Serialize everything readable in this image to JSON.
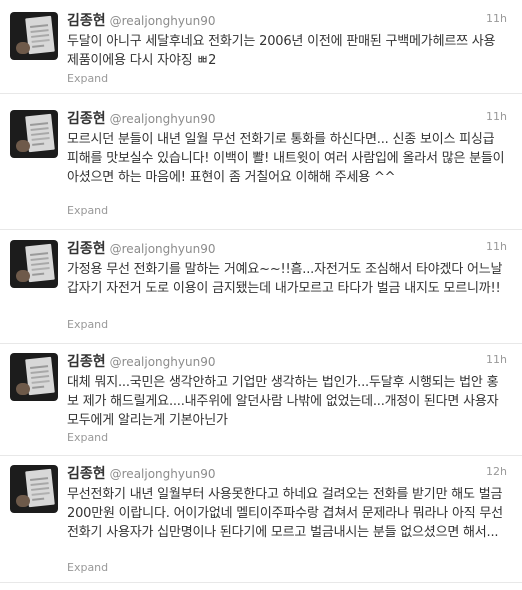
{
  "tweets": [
    {
      "name": "김종현",
      "handle": "@realjonghyun90",
      "time": "11h",
      "text": "두달이 아니구 세달후네요 전화기는 2006년 이전에 판매된 구백메가헤르쯔 사용 제품이에용 다시 자야징 ㅃ2",
      "expand": "Expand"
    },
    {
      "name": "김종현",
      "handle": "@realjonghyun90",
      "time": "11h",
      "text": "모르시던 분들이 내년 일월 무선 전화기로 통화를 하신다면... 신종 보이스 피싱급 피해를 맛보실수 있습니다! 이백이 뽤! 내트윗이 여러 사람입에 올라서 많은 분들이 아셨으면 하는 마음에! 표현이 좀 거칠어요 이해해 주세용 ^^",
      "expand": "Expand"
    },
    {
      "name": "김종현",
      "handle": "@realjonghyun90",
      "time": "11h",
      "text": "가정용 무선 전화기를 말하는 거예요~~!!흠...자전거도 조심해서 타야겠다 어느날 갑자기 자전거 도로 이용이 금지됐는데 내가모르고 타다가 벌금 내지도 모르니까!!",
      "expand": "Expand"
    },
    {
      "name": "김종현",
      "handle": "@realjonghyun90",
      "time": "11h",
      "text": "대체 뭐지...국민은 생각안하고 기업만 생각하는 법인가...두달후 시행되는 법안 홍보 제가 해드릴게요....내주위에 알던사람 나밖에 없었는데...개정이 된다면 사용자 모두에게 알리는게 기본아닌가",
      "expand": "Expand"
    },
    {
      "name": "김종현",
      "handle": "@realjonghyun90",
      "time": "12h",
      "text": "무선전화기 내년 일월부터 사용못한다고 하네요 걸려오는 전화를 받기만 해도 벌금200만원 이랍니다. 어이가없네 멜티이주파수랑 겹쳐서 문제라나 뭐라나 아직 무선전화기 사용자가 십만명이나 된다기에 모르고 벌금내시는 분들 없으셨으면 해서...",
      "expand": "Expand"
    }
  ]
}
